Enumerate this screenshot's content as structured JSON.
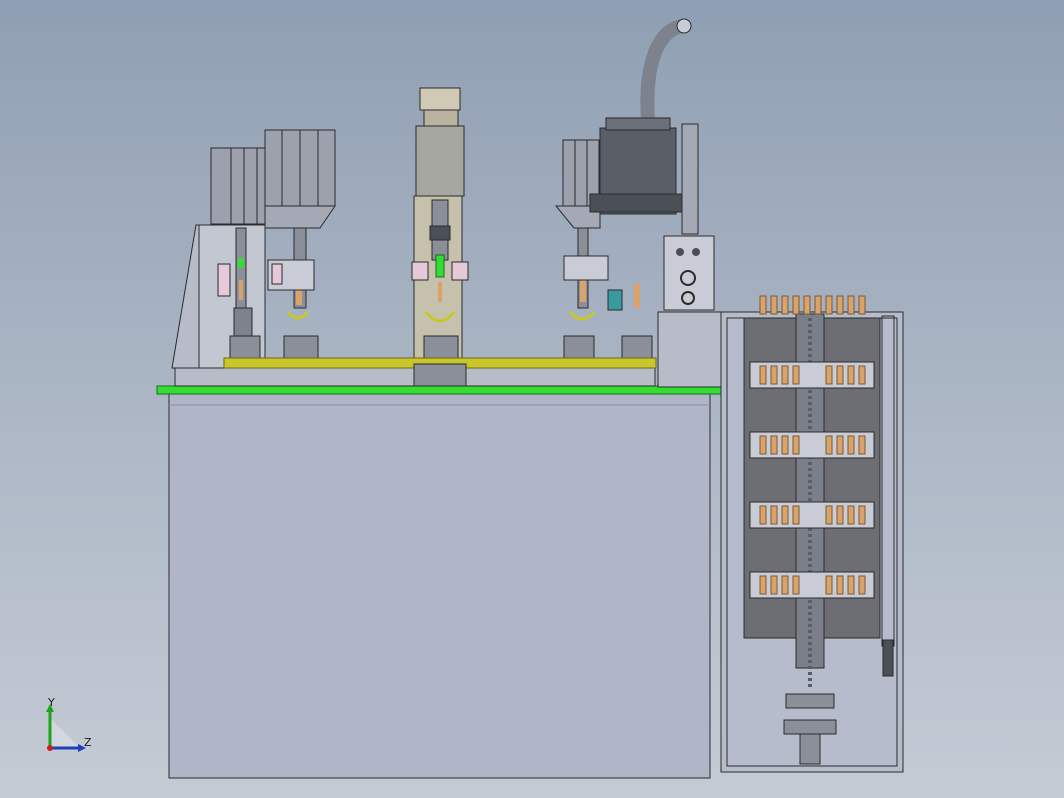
{
  "view": {
    "background_top": "#8f9fb3",
    "background_bottom": "#c4cbd5",
    "accent_green": "#33dd33",
    "accent_yellow": "#c9c62a",
    "part_copper": "#d9a36b"
  },
  "triad": {
    "y_label": "Y",
    "z_label": "Z"
  }
}
